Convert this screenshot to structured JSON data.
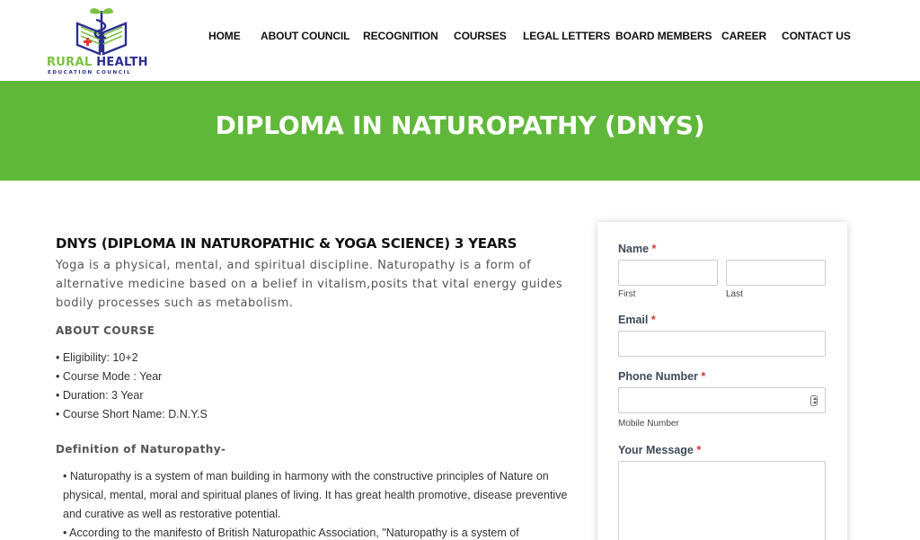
{
  "logo": {
    "title_part1": "RURAL",
    "title_part2": " HEALTH",
    "subtitle": "EDUCATION COUNCIL"
  },
  "nav": {
    "items": [
      {
        "label": "HOME"
      },
      {
        "label": "ABOUT COUNCIL"
      },
      {
        "label": "RECOGNITION"
      },
      {
        "label": "COURSES"
      },
      {
        "label": "LEGAL LETTERS"
      },
      {
        "label": "BOARD MEMBERS"
      },
      {
        "label": "CAREER"
      },
      {
        "label": "CONTACT US"
      }
    ]
  },
  "banner": {
    "title": "DIPLOMA IN NATUROPATHY (DNYS)"
  },
  "main": {
    "course_title": "DNYS (DIPLOMA IN NATUROPATHIC & YOGA SCIENCE) 3 YEARS",
    "intro": "Yoga is a physical, mental, and spiritual discipline. Naturopathy is a form of alternative medicine based on a belief in vitalism,posits that vital energy guides bodily processes such as metabolism.",
    "about_heading": "ABOUT COURSE",
    "about_items": [
      "• Eligibility: 10+2",
      "• Course Mode : Year",
      "• Duration: 3 Year",
      "• Course Short Name: D.N.Y.S"
    ],
    "definition_heading": "Definition of Naturopathy-",
    "definition_items": [
      "• Naturopathy is a system of man building in harmony with the constructive principles of Nature on physical, mental, moral and spiritual planes of living. It has great health promotive, disease preventive and curative as well as restorative potential.",
      "• According to the manifesto of British Naturopathic Association, \"Naturopathy is a system of"
    ]
  },
  "form": {
    "name_label": "Name",
    "required_mark": "*",
    "first_sublabel": "First",
    "last_sublabel": "Last",
    "email_label": "Email",
    "phone_label": "Phone Number",
    "phone_sublabel": "Mobile Number",
    "message_label": "Your Message"
  },
  "colors": {
    "brand_green": "#60b83a",
    "logo_blue": "#2b2f8f",
    "required_red": "#d63638"
  },
  "icons": {
    "logo": "book-caduceus-logo",
    "phone_spinner": "number-spinner-icon"
  }
}
